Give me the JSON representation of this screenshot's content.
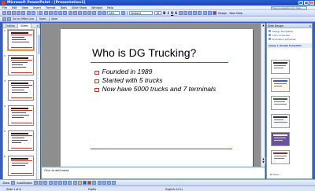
{
  "window": {
    "title": "Microsoft PowerPoint - [Presentation1]"
  },
  "menu": {
    "items": [
      "File",
      "Edit",
      "View",
      "Insert",
      "Format",
      "Tools",
      "Slide Show",
      "Window",
      "Help"
    ],
    "help_placeholder": "Type a question for help"
  },
  "toolbar": {
    "zoom": "48%",
    "font": "Verdana",
    "size": "18",
    "design_label": "Design",
    "new_slide_label": "New Slide"
  },
  "toolbar2": {
    "go_label": "Go to Office Live",
    "open_label": "Open",
    "save_label": "Save"
  },
  "outline_tabs": {
    "outline": "Outline",
    "slides": "Slides"
  },
  "thumbnails": [
    {
      "num": "1"
    },
    {
      "num": "2"
    },
    {
      "num": "3"
    },
    {
      "num": "4"
    },
    {
      "num": "5"
    },
    {
      "num": "6"
    }
  ],
  "slide": {
    "title": "Who is DG Trucking?",
    "bullets": [
      "Founded in 1989",
      "Started with 5 trucks",
      "Now have 5000 trucks and 7 terminals"
    ]
  },
  "notes": {
    "placeholder": "Click to add notes"
  },
  "task_pane": {
    "title": "Slide Design",
    "links": [
      "Design Templates",
      "Color Schemes",
      "Animation Schemes"
    ],
    "section": "Apply a design template:",
    "browse": "Browse..."
  },
  "drawbar": {
    "draw_label": "Draw",
    "autoshapes_label": "AutoShapes"
  },
  "status": {
    "slide": "Slide 1 of 6",
    "design": "Profile",
    "language": "English (U.S.)"
  }
}
